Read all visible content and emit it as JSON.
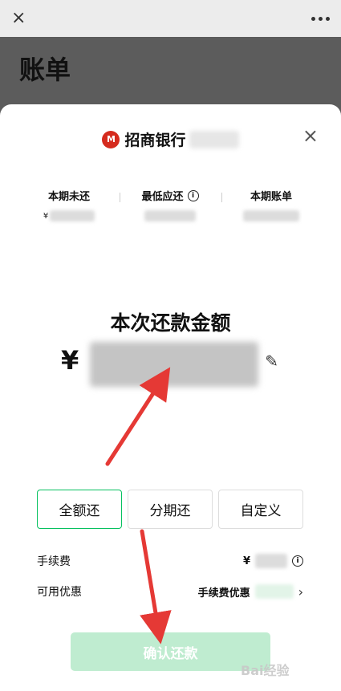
{
  "topbar": {
    "close_icon": "×",
    "more_icon": "more-dots-icon"
  },
  "page": {
    "title": "账单"
  },
  "bank": {
    "logo_text": "M",
    "name": "招商银行"
  },
  "sheet": {
    "close_icon": "×"
  },
  "stats": [
    {
      "label": "本期未还",
      "prefix": "¥"
    },
    {
      "label": "最低应还",
      "info_icon": "i"
    },
    {
      "label": "本期账单"
    }
  ],
  "payment": {
    "title": "本次还款金额",
    "currency": "¥",
    "edit_icon": "✎"
  },
  "options": [
    {
      "label": "全额还",
      "selected": true
    },
    {
      "label": "分期还",
      "selected": false
    },
    {
      "label": "自定义",
      "selected": false
    }
  ],
  "fee": {
    "label": "手续费",
    "currency": "¥",
    "info_icon": "i"
  },
  "discount": {
    "label": "可用优惠",
    "value": "手续费优惠",
    "chevron": "›"
  },
  "confirm": {
    "label": "确认还款"
  },
  "watermark": {
    "text": "Bai经验"
  },
  "colors": {
    "accent": "#07c160",
    "confirm_disabled": "#bfecd0",
    "annotation_arrow": "#e53935",
    "bank_logo": "#d52b1e"
  }
}
